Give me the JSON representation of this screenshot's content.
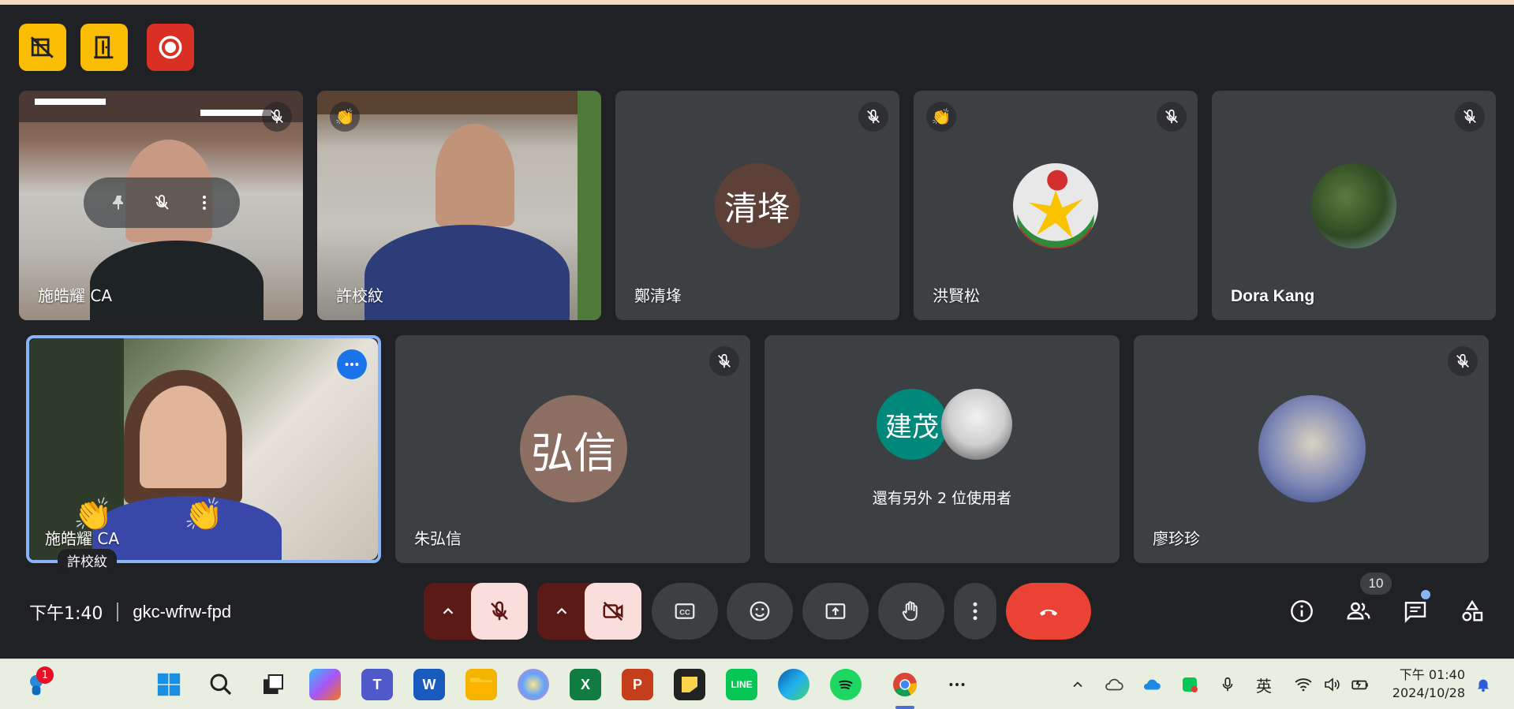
{
  "host_controls": [
    {
      "icon": "no-video-grid-icon",
      "color": "#fbbc04"
    },
    {
      "icon": "door-exit-icon",
      "color": "#fbbc04"
    },
    {
      "icon": "record-icon",
      "color": "#d93025"
    }
  ],
  "tiles": {
    "t1": {
      "name": "施皓耀 CA",
      "muted": true,
      "video": true
    },
    "t2": {
      "name": "許校紋",
      "reaction": "👏",
      "video": true
    },
    "t3": {
      "name": "鄭清埄",
      "avatar_text": "清埄",
      "avatar_color": "#5d4037",
      "muted": true
    },
    "t4": {
      "name": "洪賢松",
      "reaction": "👏",
      "muted": true
    },
    "t5": {
      "name": "Dora Kang",
      "muted": true
    },
    "t6": {
      "name": "施皓耀 CA",
      "subname": "許校紋",
      "self": true
    },
    "t7": {
      "name": "朱弘信",
      "avatar_text": "弘信",
      "avatar_color": "#8d6e63",
      "muted": true
    },
    "t8": {
      "avatar_text": "建茂",
      "avatar_color": "#00897b",
      "others_text": "還有另外 2 位使用者"
    },
    "t9": {
      "name": "廖珍珍",
      "muted": true
    }
  },
  "meeting": {
    "time": "下午1:40",
    "code": "gkc-wfrw-fpd"
  },
  "controls": {
    "participants_count": "10",
    "end_call_color": "#ea4335"
  },
  "taskbar": {
    "notification_count": "1",
    "apps": [
      "widgets",
      "start",
      "search",
      "task-view",
      "copilot",
      "teams",
      "word",
      "file-explorer",
      "paint",
      "excel",
      "powerpoint",
      "sticky-notes",
      "line",
      "edge",
      "spotify",
      "chrome",
      "more"
    ],
    "ime": "英",
    "clock_time": "下午 01:40",
    "clock_date": "2024/10/28"
  }
}
